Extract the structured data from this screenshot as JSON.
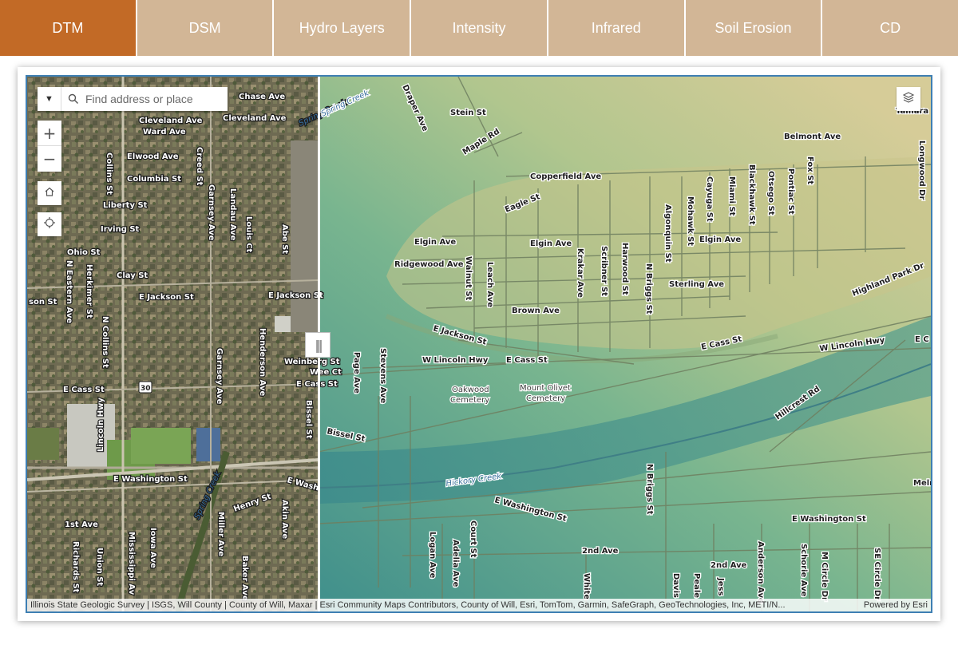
{
  "tabs": [
    {
      "label": "DTM",
      "active": true
    },
    {
      "label": "DSM",
      "active": false
    },
    {
      "label": "Hydro Layers",
      "active": false
    },
    {
      "label": "Intensity",
      "active": false
    },
    {
      "label": "Infrared",
      "active": false
    },
    {
      "label": "Soil Erosion",
      "active": false
    },
    {
      "label": "CD",
      "active": false
    }
  ],
  "colors": {
    "tab_active": "#c26a26",
    "tab_inactive": "#d2b696",
    "map_border": "#3e7fb3",
    "hillshade_low": "#4f9c8e",
    "hillshade_high": "#cfc892"
  },
  "search": {
    "placeholder": "Find address or place",
    "dropdown_icon": "caret-down-icon",
    "icon": "search-icon"
  },
  "map_controls": {
    "zoom_in": "+",
    "zoom_out": "−",
    "home_icon": "home-icon",
    "locate_icon": "locate-icon",
    "layers_icon": "layers-icon",
    "swipe_handle": "|||"
  },
  "attribution": {
    "text": "Illinois State Geologic Survey | ISGS, Will County | County of Will, Maxar | Esri Community Maps Contributors, County of Will, Esri, TomTom, Garmin, SafeGraph, GeoTechnologies, Inc, METI/N...",
    "powered_by": "Powered by Esri"
  },
  "left_map_labels": {
    "chase_ave": "Chase Ave",
    "cleveland_ave_1": "Cleveland Ave",
    "cleveland_ave_2": "Cleveland Ave",
    "ward_ave": "Ward Ave",
    "elwood_ave": "Elwood Ave",
    "collins_st": "Collins St",
    "columbia_st": "Columbia St",
    "liberty_st": "Liberty St",
    "irving_st": "Irving St",
    "ohio_st": "Ohio St",
    "n_eastern_ave": "N Eastern Ave",
    "herkimer_st": "Herkimer St",
    "clay_st": "Clay St",
    "e_jackson_st_left": "E Jackson St",
    "e_jackson_st_mid": "E Jackson St",
    "son_st": "son St",
    "n_collins_st": "N Collins St",
    "henderson_ave": "Henderson Ave",
    "garnsey_ave_1": "Garnsey Ave",
    "garnsey_ave_2": "Garnsey Ave",
    "landau_ave": "Landau Ave",
    "louis_ct": "Louis Ct",
    "abe_st": "Abe St",
    "creed_st": "Creed St",
    "weinberg_st": "Weinberg St",
    "wee_ct": "Wee Ct",
    "e_cass_st_left": "E Cass St",
    "e_cass_st_mid": "E Cass St",
    "route_30": "30",
    "lincoln_hwy": "Lincoln Hwy",
    "bissel_st": "Bissel St",
    "e_washington_st": "E Washington St",
    "e_wash_partial": "E Wash",
    "spring_creek_1": "Spring Creek",
    "spring_creek_2": "Spring Creek",
    "henry_st": "Henry St",
    "akin_ave": "Akin Ave",
    "first_ave": "1st Ave",
    "iowa_ave": "Iowa Ave",
    "mississippi_av": "Mississippi Av",
    "miller_ave": "Miller Ave",
    "baker_ave": "Baker Ave",
    "richards_st": "Richards St",
    "union_st": "Union St"
  },
  "right_map_labels": {
    "draper_ave": "Draper Ave",
    "stein_st": "Stein St",
    "maple_rd": "Maple Rd",
    "belmont_ave": "Belmont Ave",
    "tamarack": "Tamara",
    "longwood_dr": "Longwood Dr",
    "copperfield_ave": "Copperfield Ave",
    "eagle_st": "Eagle St",
    "fox_st": "Fox St",
    "pontiac_st": "Pontiac St",
    "otsego_st": "Otsego St",
    "blackhawk_st": "Blackhawk St",
    "miami_st": "Miami St",
    "cayuga_st": "Cayuga St",
    "mohawk_st": "Mohawk St",
    "algonquin_st": "Algonquin St",
    "elgin_ave_1": "Elgin Ave",
    "elgin_ave_2": "Elgin Ave",
    "elgin_ave_3": "Elgin Ave",
    "ridgewood_ave": "Ridgewood Ave",
    "walnut_st": "Walnut St",
    "leach_ave": "Leach Ave",
    "krakar_ave": "Krakar Ave",
    "scribner_st": "Scribner St",
    "harwood_st": "Harwood St",
    "n_briggs_st": "N Briggs St",
    "sterling_ave": "Sterling Ave",
    "highland_park_dr": "Highland Park Dr",
    "brown_ave": "Brown Ave",
    "e_jackson_st": "E Jackson St",
    "e_cass_st_1": "E Cass St",
    "e_cass_st_2": "E Cass St",
    "w_lincoln_hwy_1": "W Lincoln Hwy",
    "w_lincoln_hwy_2": "W Lincoln Hwy",
    "ec": "E C",
    "page_ave": "Page Ave",
    "stevens_ave": "Stevens Ave",
    "oakwood_1": "Oakwood",
    "oakwood_2": "Cemetery",
    "mount_olivet_1": "Mount Olivet",
    "mount_olivet_2": "Cemetery",
    "hillcrest_rd": "Hillcrest Rd",
    "bissel_st": "Bissel St",
    "hickory_creek": "Hickory Creek",
    "e_washington_st_1": "E Washington St",
    "e_washington_st_2": "E Washington St",
    "n_briggs_st_2": "N Briggs St",
    "melr": "Melr",
    "logan_ave": "Logan Ave",
    "adelia_ave": "Adelia Ave",
    "court_st": "Court St",
    "second_ave_1": "2nd Ave",
    "second_ave_2": "2nd Ave",
    "white": "White",
    "davis": "Davis",
    "peale": "Peale",
    "jesse": "Jess",
    "anderson_ave": "Anderson Ave",
    "schorie_ave": "Schorie Ave",
    "m_circle_dr": "M Circle Dr",
    "se_circle_dr": "SE Circle Dr",
    "spring_creek": "Spring Creek"
  }
}
